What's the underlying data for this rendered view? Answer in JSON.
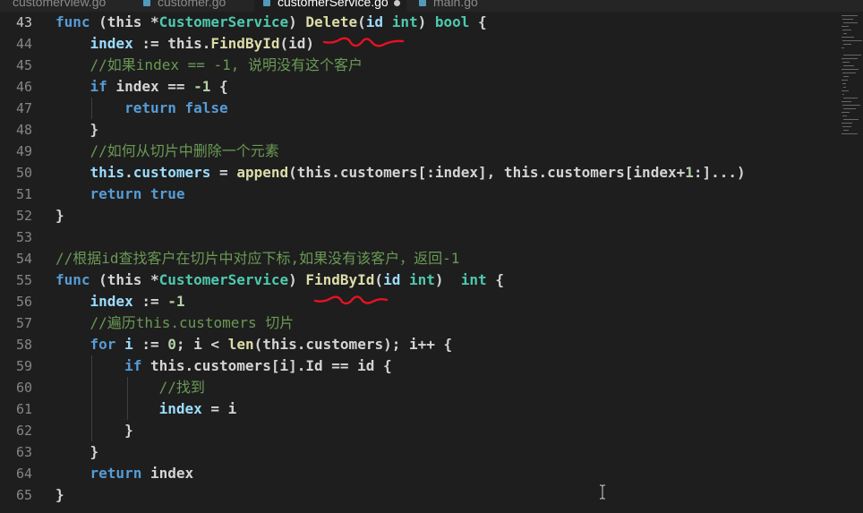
{
  "tabs": [
    {
      "label": "customerview.go",
      "active": false,
      "modified": false
    },
    {
      "label": "customer.go",
      "active": false,
      "modified": false
    },
    {
      "label": "customerService.go",
      "active": true,
      "modified": true
    },
    {
      "label": "main.go",
      "active": false,
      "modified": false
    }
  ],
  "lines": [
    {
      "n": "43",
      "t": [
        [
          "kw",
          "func"
        ],
        [
          "tx",
          " (this *"
        ],
        [
          "ty",
          "CustomerService"
        ],
        [
          "tx",
          ") "
        ],
        [
          "fn",
          "Delete"
        ],
        [
          "tx",
          "("
        ],
        [
          "id",
          "id"
        ],
        [
          "tx",
          " "
        ],
        [
          "ty",
          "int"
        ],
        [
          "tx",
          ") "
        ],
        [
          "ty",
          "bool"
        ],
        [
          "tx",
          " {"
        ]
      ]
    },
    {
      "n": "44",
      "t": [
        [
          "tx",
          "    "
        ],
        [
          "id",
          "index"
        ],
        [
          "tx",
          " := this."
        ],
        [
          "fn",
          "FindById"
        ],
        [
          "tx",
          "(id)"
        ]
      ]
    },
    {
      "n": "45",
      "t": [
        [
          "tx",
          "    "
        ],
        [
          "cm",
          "//如果index == -1, 说明没有这个客户"
        ]
      ]
    },
    {
      "n": "46",
      "t": [
        [
          "tx",
          "    "
        ],
        [
          "kw",
          "if"
        ],
        [
          "tx",
          " index == "
        ],
        [
          "num",
          "-1"
        ],
        [
          "tx",
          " {"
        ]
      ]
    },
    {
      "n": "47",
      "t": [
        [
          "tx",
          "        "
        ],
        [
          "kw",
          "return"
        ],
        [
          "tx",
          " "
        ],
        [
          "kw",
          "false"
        ]
      ]
    },
    {
      "n": "48",
      "t": [
        [
          "tx",
          "    }"
        ]
      ]
    },
    {
      "n": "49",
      "t": [
        [
          "tx",
          "    "
        ],
        [
          "cm",
          "//如何从切片中删除一个元素"
        ]
      ]
    },
    {
      "n": "50",
      "t": [
        [
          "tx",
          "    "
        ],
        [
          "id",
          "this"
        ],
        [
          "tx",
          "."
        ],
        [
          "id",
          "customers"
        ],
        [
          "tx",
          " = "
        ],
        [
          "fn",
          "append"
        ],
        [
          "tx",
          "(this.customers[:index], this.customers[index+"
        ],
        [
          "num",
          "1"
        ],
        [
          "tx",
          ":]...)"
        ]
      ]
    },
    {
      "n": "51",
      "t": [
        [
          "tx",
          "    "
        ],
        [
          "kw",
          "return"
        ],
        [
          "tx",
          " "
        ],
        [
          "kw",
          "true"
        ]
      ]
    },
    {
      "n": "52",
      "t": [
        [
          "tx",
          "}"
        ]
      ]
    },
    {
      "n": "53",
      "t": []
    },
    {
      "n": "54",
      "t": [
        [
          "cm",
          "//根据id查找客户在切片中对应下标,如果没有该客户，返回-1"
        ]
      ]
    },
    {
      "n": "55",
      "t": [
        [
          "kw",
          "func"
        ],
        [
          "tx",
          " (this *"
        ],
        [
          "ty",
          "CustomerService"
        ],
        [
          "tx",
          ") "
        ],
        [
          "fn",
          "FindById"
        ],
        [
          "tx",
          "("
        ],
        [
          "id",
          "id"
        ],
        [
          "tx",
          " "
        ],
        [
          "ty",
          "int"
        ],
        [
          "tx",
          ")  "
        ],
        [
          "ty",
          "int"
        ],
        [
          "tx",
          " {"
        ]
      ]
    },
    {
      "n": "56",
      "t": [
        [
          "tx",
          "    "
        ],
        [
          "id",
          "index"
        ],
        [
          "tx",
          " := "
        ],
        [
          "num",
          "-1"
        ]
      ]
    },
    {
      "n": "57",
      "t": [
        [
          "tx",
          "    "
        ],
        [
          "cm",
          "//遍历this.customers 切片"
        ]
      ]
    },
    {
      "n": "58",
      "t": [
        [
          "tx",
          "    "
        ],
        [
          "kw",
          "for"
        ],
        [
          "tx",
          " "
        ],
        [
          "id",
          "i"
        ],
        [
          "tx",
          " := "
        ],
        [
          "num",
          "0"
        ],
        [
          "tx",
          "; i < "
        ],
        [
          "fn",
          "len"
        ],
        [
          "tx",
          "(this.customers); i++ {"
        ]
      ]
    },
    {
      "n": "59",
      "t": [
        [
          "tx",
          "        "
        ],
        [
          "kw",
          "if"
        ],
        [
          "tx",
          " this.customers[i].Id == id {"
        ]
      ]
    },
    {
      "n": "60",
      "t": [
        [
          "tx",
          "            "
        ],
        [
          "cm",
          "//找到"
        ]
      ]
    },
    {
      "n": "61",
      "t": [
        [
          "tx",
          "            "
        ],
        [
          "id",
          "index"
        ],
        [
          "tx",
          " = i"
        ]
      ]
    },
    {
      "n": "62",
      "t": [
        [
          "tx",
          "        }"
        ]
      ]
    },
    {
      "n": "63",
      "t": [
        [
          "tx",
          "    }"
        ]
      ]
    },
    {
      "n": "64",
      "t": [
        [
          "tx",
          "    "
        ],
        [
          "kw",
          "return"
        ],
        [
          "tx",
          " index"
        ]
      ]
    },
    {
      "n": "65",
      "t": [
        [
          "tx",
          "}"
        ]
      ]
    }
  ],
  "colors": {
    "background": "#1e1e1e",
    "keyword": "#569cd6",
    "function": "#dcdcaa",
    "variable": "#9cdcfe",
    "type": "#4ec9b0",
    "number": "#b5cea8",
    "comment": "#6a9955",
    "annotation": "#e81123"
  }
}
